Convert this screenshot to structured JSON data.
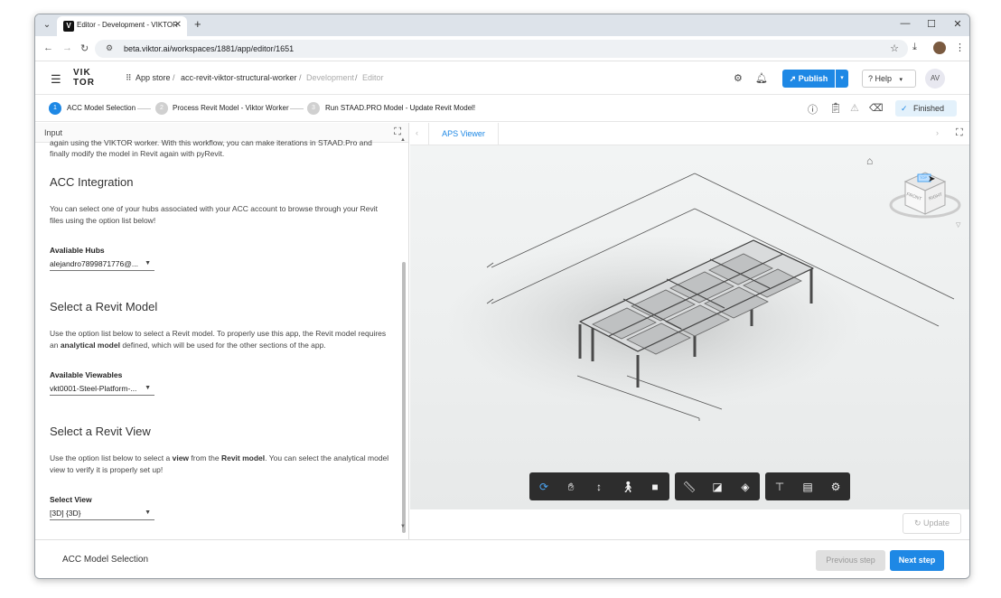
{
  "browser": {
    "tab_title": "Editor - Development - VIKTOR",
    "tab_favicon": "V",
    "url": "beta.viktor.ai/workspaces/1881/app/editor/1651"
  },
  "header": {
    "logo_line1": "VIK",
    "logo_line2": "TOR",
    "breadcrumbs": [
      "App store",
      "acc-revit-viktor-structural-worker",
      "Development",
      "Editor"
    ],
    "publish_label": "Publish",
    "help_label": "Help",
    "avatar_initials": "AV"
  },
  "stepper": {
    "steps": [
      {
        "num": "1",
        "label": "ACC Model Selection"
      },
      {
        "num": "2",
        "label": "Process Revit Model - Viktor Worker"
      },
      {
        "num": "3",
        "label": "Run STAAD.PRO Model - Update Revit Model!"
      }
    ],
    "status_label": "Finished"
  },
  "input_panel": {
    "title": "Input",
    "intro_partial_1": "again using the VIKTOR worker. With this workflow, you can make iterations in STAAD.Pro and",
    "intro_partial_2": "finally modify the model in Revit again with pyRevit.",
    "acc_heading": "ACC Integration",
    "acc_text": "You can select one of your hubs associated with your ACC account to browse through your Revit files using the option list below!",
    "hubs_label": "Avaliable Hubs",
    "hubs_value": "alejandro7899871776@...",
    "model_heading": "Select a Revit Model",
    "model_text_1": "Use the option list below to select a Revit model. To properly use this app, the Revit model requires an ",
    "model_text_bold": "analytical model",
    "model_text_2": " defined, which will be used for the other sections of the app.",
    "viewables_label": "Available Viewables",
    "viewables_value": "vkt0001-Steel-Platform-...",
    "view_heading": "Select a Revit View",
    "view_text_1": "Use the option list below to select a ",
    "view_text_bold1": "view",
    "view_text_2": " from the ",
    "view_text_bold2": "Revit model",
    "view_text_3": ". You can select the analytical model view to verify it is properly set up!",
    "view_label": "Select View",
    "view_value": "[3D] {3D}"
  },
  "viewer": {
    "tab_label": "APS Viewer",
    "viewcube_front": "FRONT",
    "viewcube_right": "RIGHT",
    "viewcube_top": "TOP",
    "update_label": "Update"
  },
  "footer": {
    "title": "ACC Model Selection",
    "prev_label": "Previous step",
    "next_label": "Next step"
  },
  "colors": {
    "accent": "#1e88e5",
    "toolbar_bg": "#2d2d2d"
  }
}
